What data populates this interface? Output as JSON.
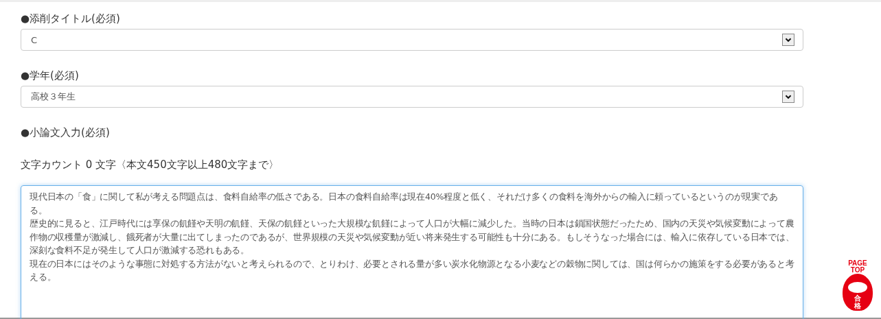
{
  "fields": [
    {
      "kind": "select",
      "label": "●添削タイトル(必須)",
      "value": "C"
    },
    {
      "kind": "select",
      "label": "●学年(必須)",
      "value": "高校３年生"
    },
    {
      "kind": "textarea",
      "label": "●小論文入力(必須)",
      "counter": "文字カウント 0 文字〈本文450文字以上480文字まで〉",
      "paragraphs": [
        "現代日本の「食」に関して私が考える問題点は、食料自給率の低さである。日本の食料自給率は現在40%程度と低く、それだけ多くの食料を海外からの輸入に頼っているというのが現実である。",
        "歴史的に見ると、江戸時代には享保の飢饉や天明の飢饉、天保の飢饉といった大規模な飢饉によって人口が大幅に減少した。当時の日本は鎖国状態だったため、国内の天災や気候変動によって農作物の収穫量が激減し、餓死者が大量に出てしまったのであるが、世界規模の天災や気候変動が近い将来発生する可能性も十分にある。もしそうなった場合には、輸入に依存している日本では、深刻な食料不足が発生して人口が激減する恐れもある。",
        "現在の日本にはそのような事態に対処する方法がないと考えられるので、とりわけ、必要とされる量が多い炭水化物源となる小麦などの穀物に関しては、国は何らかの施策をする必要があると考える。"
      ]
    }
  ],
  "page_top": {
    "label": "PAGE TOP",
    "badge": "合格"
  }
}
